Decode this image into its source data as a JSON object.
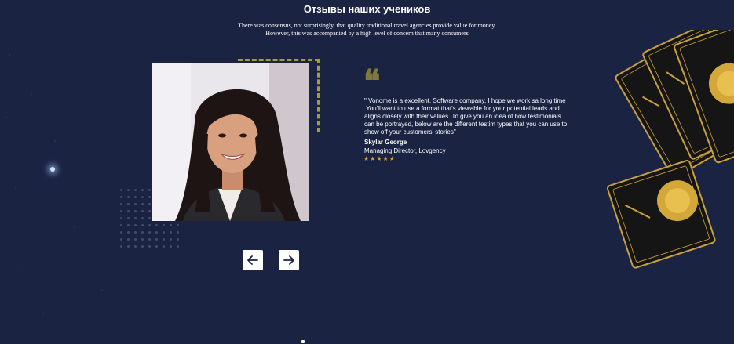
{
  "section": {
    "title": "Отзывы наших учеников",
    "subtitle_line1": "There was consensus, not surprisingly, that quality traditional travel agencies provide value for money.",
    "subtitle_line2": "However, this was accompanied by a high level of concern that many consumers"
  },
  "testimonial": {
    "quote": "\" Vonome is a excellent, Software company, I hope we work sa long time .You'll want to use a format that's viewable for your potential leads and aligns closely with their values. To give you an idea of how testimonials can be portrayed, below are the different testim types that you can use to show off your customers' stories\"",
    "author_name": "Skylar George",
    "author_role": "Managing Director, Lovgency",
    "rating": 5,
    "rating_display": "★★★★★"
  },
  "icons": {
    "quote": "quote-icon",
    "prev": "arrow-left-icon",
    "next": "arrow-right-icon"
  },
  "colors": {
    "background": "#1b2343",
    "accent_gold": "#a89b3a",
    "star": "#e0a030"
  }
}
